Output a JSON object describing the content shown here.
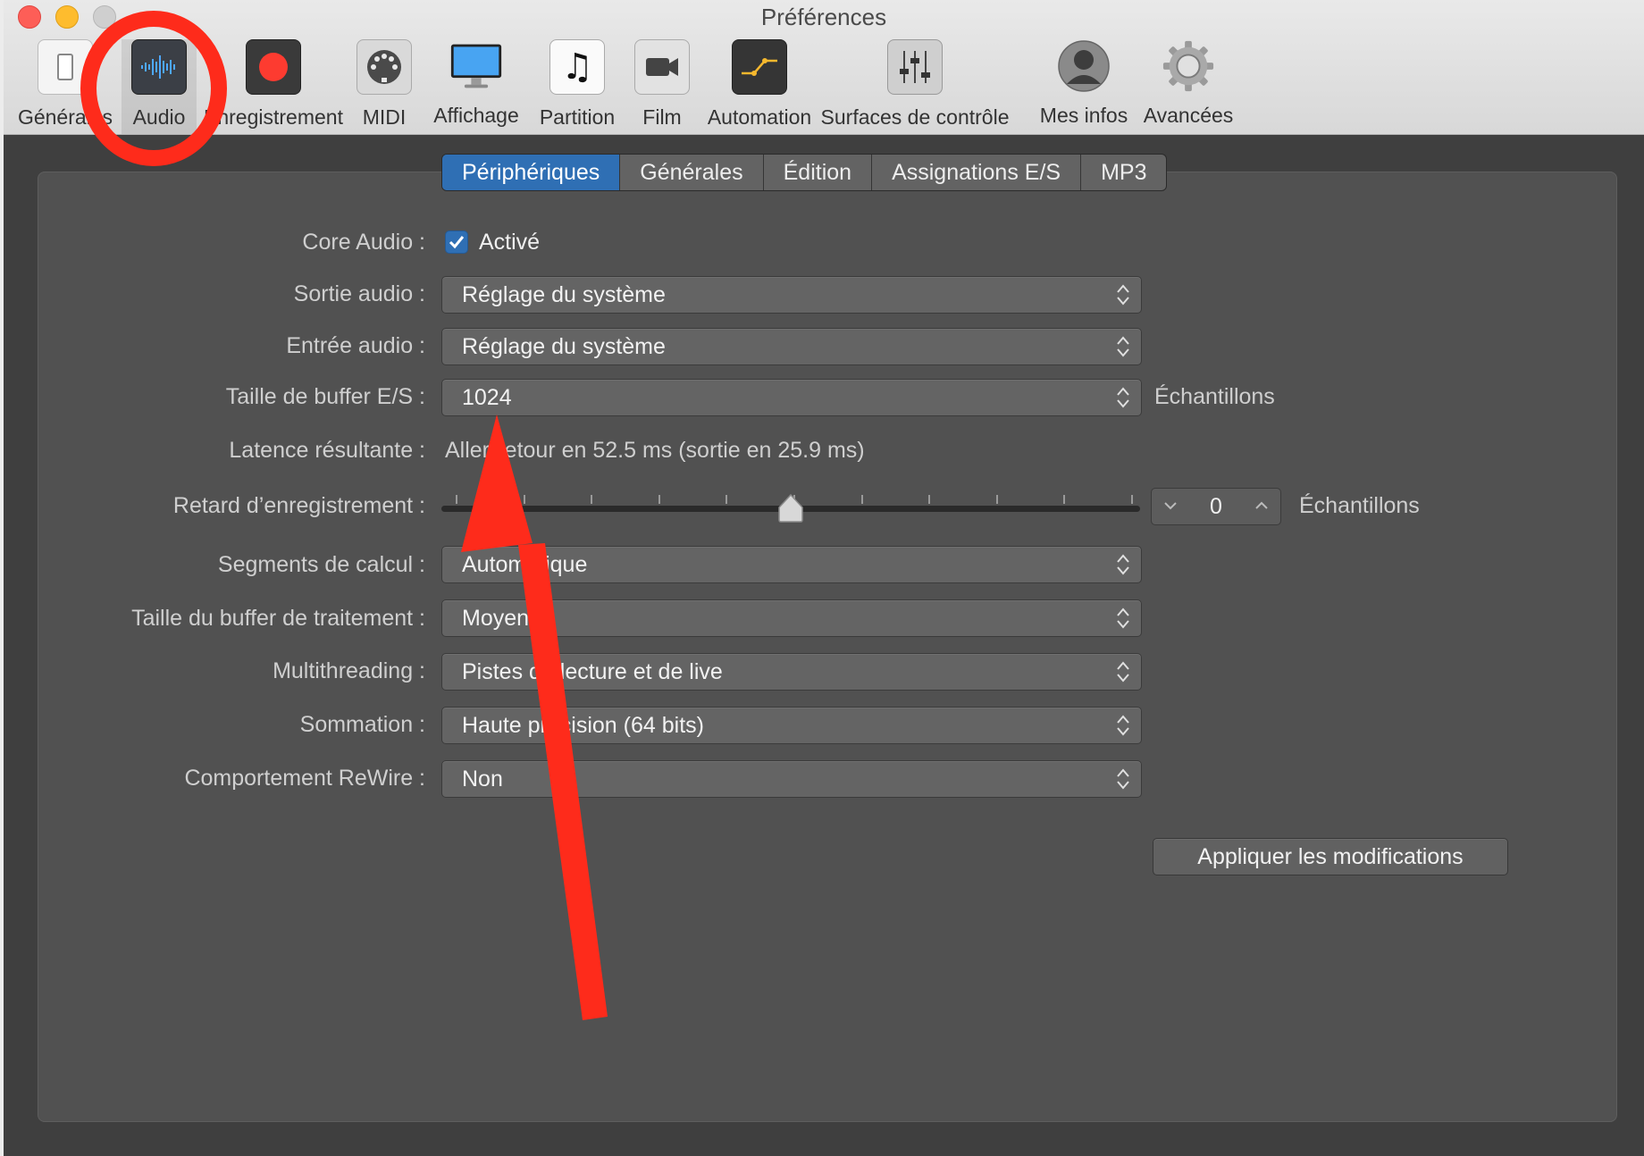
{
  "window": {
    "title": "Préférences"
  },
  "toolbar": {
    "items": [
      {
        "label": "Générales",
        "icon": "general-switch-icon"
      },
      {
        "label": "Audio",
        "icon": "audio-waveform-icon",
        "selected": true
      },
      {
        "label": "Enregistrement",
        "icon": "record-icon"
      },
      {
        "label": "MIDI",
        "icon": "midi-connector-icon"
      },
      {
        "label": "Affichage",
        "icon": "display-monitor-icon"
      },
      {
        "label": "Partition",
        "icon": "music-note-icon"
      },
      {
        "label": "Film",
        "icon": "video-camera-icon"
      },
      {
        "label": "Automation",
        "icon": "automation-curve-icon"
      },
      {
        "label": "Surfaces de contrôle",
        "icon": "mixer-faders-icon"
      },
      {
        "label": "Mes infos",
        "icon": "user-silhouette-icon"
      },
      {
        "label": "Avancées",
        "icon": "gear-icon"
      }
    ]
  },
  "tabs": [
    {
      "label": "Périphériques",
      "active": true
    },
    {
      "label": "Générales"
    },
    {
      "label": "Édition"
    },
    {
      "label": "Assignations E/S"
    },
    {
      "label": "MP3"
    }
  ],
  "form": {
    "core_audio": {
      "label": "Core Audio :",
      "checkbox_label": "Activé",
      "checked": true
    },
    "output": {
      "label": "Sortie audio :",
      "value": "Réglage du système"
    },
    "input": {
      "label": "Entrée audio :",
      "value": "Réglage du système"
    },
    "buffer": {
      "label": "Taille de buffer E/S :",
      "value": "1024",
      "unit": "Échantillons"
    },
    "latency": {
      "label": "Latence résultante :",
      "value": "Aller-retour en 52.5 ms (sortie en 25.9 ms)"
    },
    "record_delay": {
      "label": "Retard d’enregistrement :",
      "value": "0",
      "unit": "Échantillons",
      "slider_level": 0.5
    },
    "segments": {
      "label": "Segments de calcul :",
      "value": "Automatique"
    },
    "process_buffer": {
      "label": "Taille du buffer de traitement :",
      "value": "Moyenne"
    },
    "multithreading": {
      "label": "Multithreading :",
      "value": "Pistes de lecture et de live"
    },
    "summing": {
      "label": "Sommation :",
      "value": "Haute précision (64 bits)"
    },
    "rewire": {
      "label": "Comportement ReWire :",
      "value": "Non"
    }
  },
  "apply_button": {
    "label": "Appliquer les modifications"
  },
  "colors": {
    "accent": "#2f6fb4",
    "annotation": "#fe2b1b",
    "panel": "#515151"
  }
}
